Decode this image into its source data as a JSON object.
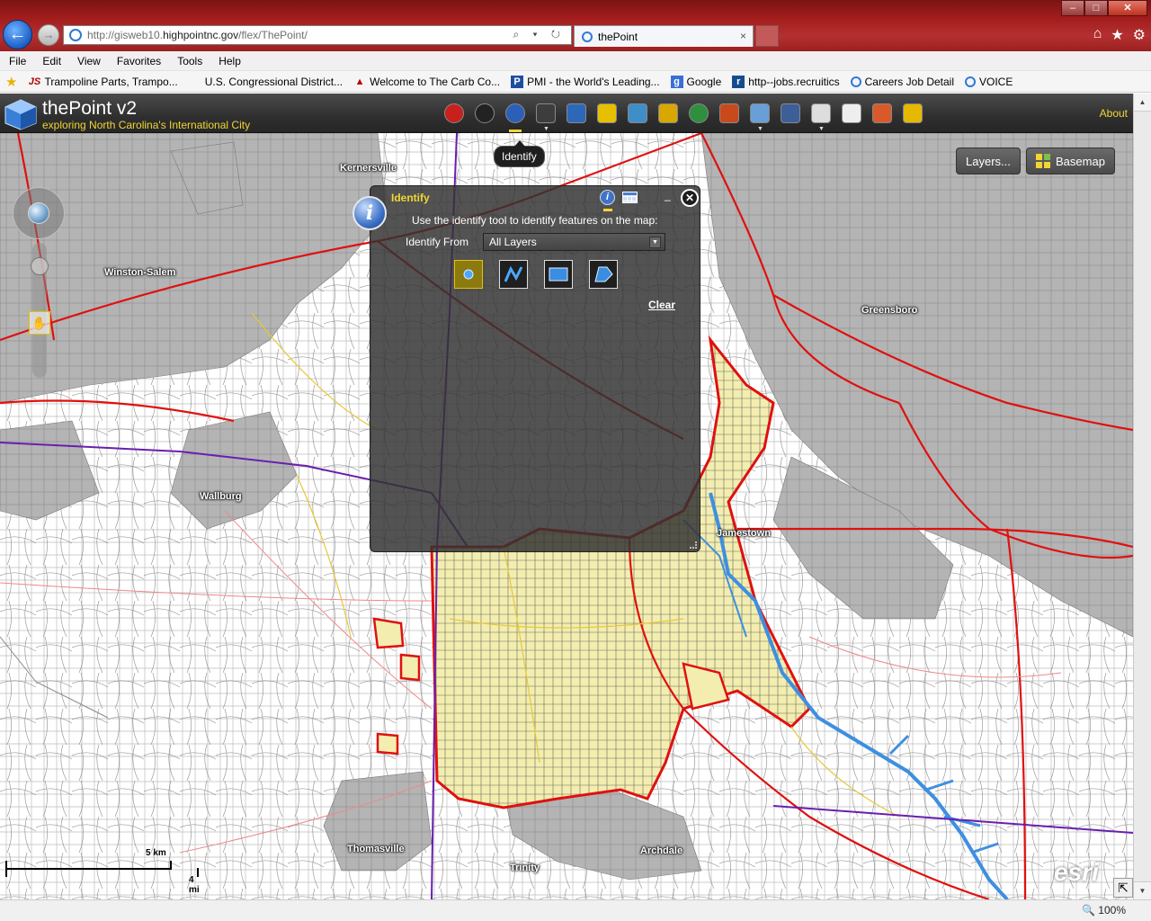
{
  "browser": {
    "url_prefix": "http://gisweb10.",
    "url_domain": "highpointnc.gov",
    "url_path": "/flex/ThePoint/",
    "tab_title": "thePoint",
    "tab_close": "×",
    "back_glyph": "←",
    "fwd_glyph": "→",
    "addr_tools": "⌕ ▾ ↻",
    "chrome_icons": [
      "⌂",
      "★",
      "⚙"
    ],
    "window": {
      "min": "–",
      "max": "□",
      "close": "✕"
    }
  },
  "menu": [
    "File",
    "Edit",
    "View",
    "Favorites",
    "Tools",
    "Help"
  ],
  "favorites": [
    {
      "label": "Trampoline Parts, Trampo...",
      "icon": "js-icon",
      "glyph": "JS",
      "cls": "js"
    },
    {
      "label": "U.S. Congressional District...",
      "icon": "blank-page-icon",
      "glyph": "",
      "cls": "blank"
    },
    {
      "label": "Welcome to The Carb Co...",
      "icon": "carb-icon",
      "glyph": "▲",
      "cls": "carb"
    },
    {
      "label": "PMI - the World's Leading...",
      "icon": "pmi-icon",
      "glyph": "P",
      "cls": "pmi"
    },
    {
      "label": "Google",
      "icon": "google-icon",
      "glyph": "g",
      "cls": "goog"
    },
    {
      "label": "http--jobs.recruitics",
      "icon": "recruitics-icon",
      "glyph": "r",
      "cls": "rec"
    },
    {
      "label": "Careers  Job Detail",
      "icon": "ie-page-icon",
      "glyph": "",
      "cls": "ie"
    },
    {
      "label": "VOICE",
      "icon": "ie-page-icon",
      "glyph": "",
      "cls": "ie"
    }
  ],
  "app": {
    "title": "thePoint v2",
    "subtitle": "exploring North Carolina's International City",
    "about": "About",
    "tooltip": "Identify",
    "layers_btn": "Layers...",
    "basemap_btn": "Basemap",
    "tool_colors": [
      "#c8201c",
      "#222222",
      "#2c5fb8",
      "#3d3d3d",
      "#2d68b8",
      "#e6c000",
      "#3f8ec8",
      "#d8a800",
      "#2f8f3e",
      "#c84a1c",
      "#6a9ed8",
      "#3d5f98",
      "#dddddd",
      "#eeeeee",
      "#d85a2a",
      "#e6b800"
    ],
    "tools": [
      "Red Zone",
      "Crosshair",
      "Identify",
      "Draw",
      "Table",
      "Navigate",
      "Layers",
      "Security",
      "Globe",
      "Tools",
      "Measure",
      "Print",
      "Hand",
      "Download",
      "Report",
      "Key"
    ]
  },
  "identify": {
    "title": "Identify",
    "badge": "i",
    "info": "i",
    "minimize": "_",
    "close": "✕",
    "description": "Use the identify tool to identify features on the map:",
    "from_label": "Identify From",
    "from_value": "All Layers",
    "caret": "▼",
    "clear": "Clear",
    "tools": [
      "point",
      "polyline",
      "extent",
      "polygon"
    ]
  },
  "map_labels": [
    {
      "name": "Kernersville"
    },
    {
      "name": "Winston-Salem"
    },
    {
      "name": "Greensboro"
    },
    {
      "name": "Wallburg"
    },
    {
      "name": "Jamestown"
    },
    {
      "name": "Thomasville"
    },
    {
      "name": "Archdale"
    },
    {
      "name": "Trinity"
    }
  ],
  "scale": {
    "km": "5 km",
    "mi": "4 mi"
  },
  "esri": {
    "logo": "esri",
    "powered": "POWERED BY"
  },
  "status": {
    "zoom": "🔍 100%"
  },
  "colors": {
    "accent": "#f2d534",
    "city_fill": "#f4f0b0",
    "boundary": "#e01010",
    "water": "#3e8fe0",
    "muni_gray": "#b0b0b0"
  }
}
